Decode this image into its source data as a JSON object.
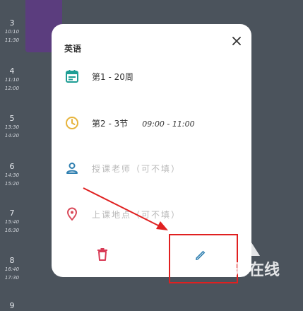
{
  "timeline": [
    {
      "num": "3",
      "start": "10:10",
      "end": "11:30"
    },
    {
      "num": "4",
      "start": "11:10",
      "end": "12:00"
    },
    {
      "num": "5",
      "start": "13:30",
      "end": "14:20"
    },
    {
      "num": "6",
      "start": "14:30",
      "end": "15:20"
    },
    {
      "num": "7",
      "start": "15:40",
      "end": "16:30"
    },
    {
      "num": "8",
      "start": "16:40",
      "end": "17:30"
    },
    {
      "num": "9",
      "start": "",
      "end": ""
    }
  ],
  "dialog": {
    "course_name": "英语",
    "weeks": "第1 - 20周",
    "sections": "第2 - 3节",
    "time_range": "09:00 - 11:00",
    "teacher_placeholder": "授课老师（可不填）",
    "location_placeholder": "上课地点（可不填）"
  },
  "icons": {
    "close": "close-icon",
    "calendar": "calendar-icon",
    "clock": "clock-icon",
    "person": "person-icon",
    "location": "location-pin-icon",
    "delete": "trash-icon",
    "edit": "pencil-icon"
  },
  "colors": {
    "calendar": "#1f9e95",
    "clock": "#e7b43c",
    "person": "#2f7fb0",
    "location": "#d94a5a",
    "delete": "#d83a55",
    "edit": "#2f7fb0",
    "annotation": "#e02020",
    "course_block": "#5b3d7e"
  },
  "watermark": "开在线"
}
